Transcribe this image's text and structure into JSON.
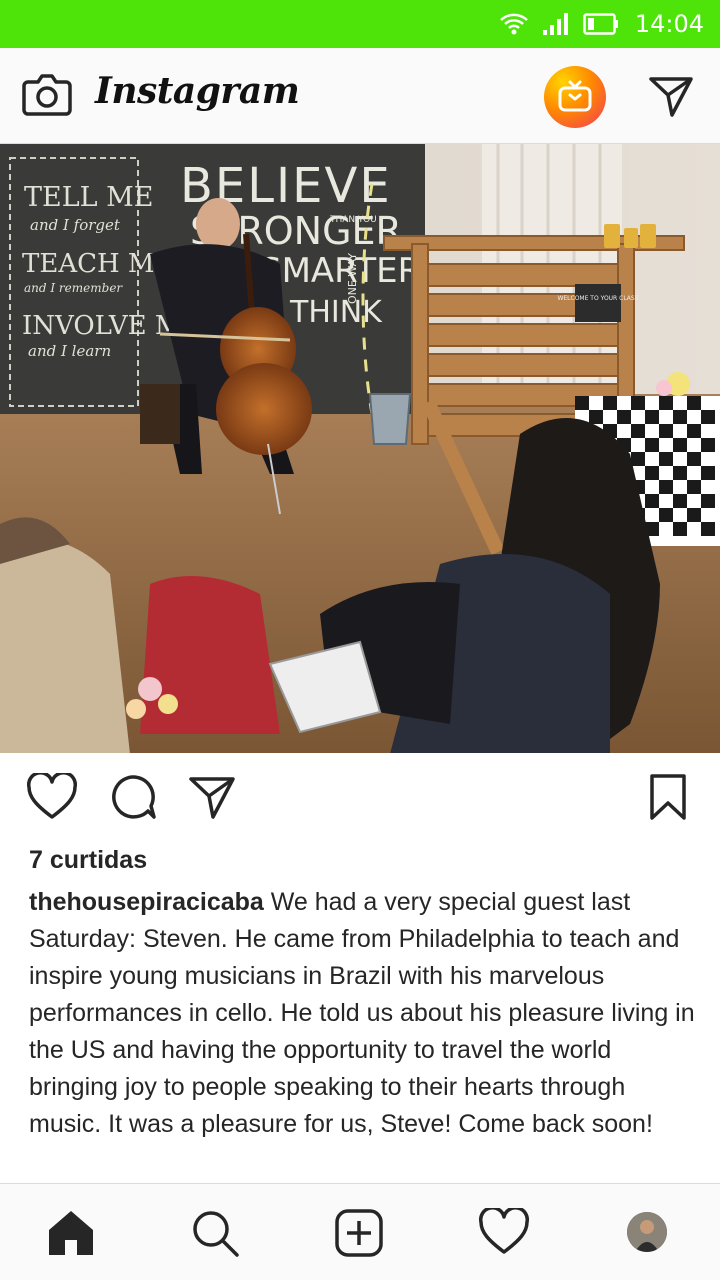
{
  "status_bar": {
    "time": "14:04",
    "icons": [
      "wifi-icon",
      "signal-icon",
      "battery-icon"
    ]
  },
  "header": {
    "title": "Instagram",
    "icons": [
      "camera-icon",
      "igtv-icon",
      "direct-message-icon"
    ]
  },
  "post": {
    "image_text": {
      "believe": "BELIEVE",
      "stronger": "STRONGER",
      "than_you": "THAN YOU",
      "smarter": "SMARTER",
      "think": "THINK",
      "one_way": "ONE WAY",
      "tell_me": "TELL ME",
      "and_i_forget": "and I forget",
      "teach_me": "TEACH ME",
      "and_i_remember": "and I remember",
      "involve_me": "INVOLVE ME",
      "and_i_learn": "and I learn",
      "welcome_sign": "WELCOME TO YOUR CLASS"
    },
    "likes": "7 curtidas",
    "username": "thehousepiracicaba",
    "caption": " We had a very special guest last Saturday: Steven. He came from Philadelphia to teach and inspire young musicians in Brazil with his marvelous performances in cello. He told us about his pleasure living in the US and having the opportunity to travel the world bringing joy to people speaking to their hearts through music. It was a pleasure for us, Steve! Come back soon!",
    "action_icons": [
      "heart-icon",
      "comment-icon",
      "share-icon",
      "bookmark-icon"
    ]
  },
  "bottom_nav": {
    "items": [
      "home-icon",
      "search-icon",
      "add-post-icon",
      "activity-heart-icon",
      "profile-avatar"
    ]
  },
  "colors": {
    "status_bar": "#4ee40a",
    "bar_background": "#fafafa",
    "text": "#262626"
  }
}
